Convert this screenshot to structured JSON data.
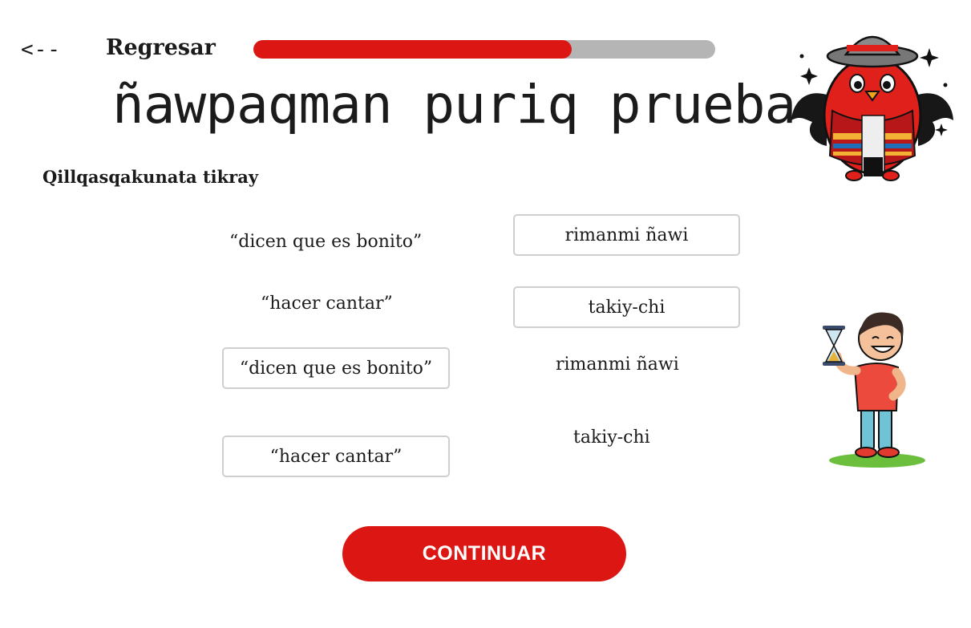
{
  "header": {
    "back_arrow": "<--",
    "back_label": "Regresar",
    "progress": 0.69
  },
  "title": "ñawpaqman puriq prueba",
  "instruction": "Qillqasqakunata tikray",
  "exercise": {
    "rows": [
      {
        "phrase": "“dicen que es bonito”",
        "option": "rimanmi ñawi"
      },
      {
        "phrase": "“hacer cantar”",
        "option": "takiy-chi"
      },
      {
        "option": "“dicen que es bonito”",
        "phrase": "rimanmi ñawi"
      },
      {
        "option": "“hacer cantar”",
        "phrase": "takiy-chi"
      }
    ]
  },
  "continue_label": "CONTINUAR",
  "colors": {
    "accent": "#dc1613",
    "track": "#b5b5b5",
    "box_border": "#cfcfcf"
  },
  "icons": {
    "mascot": "red-bird-mascot-icon",
    "character": "boy-hourglass-icon"
  }
}
